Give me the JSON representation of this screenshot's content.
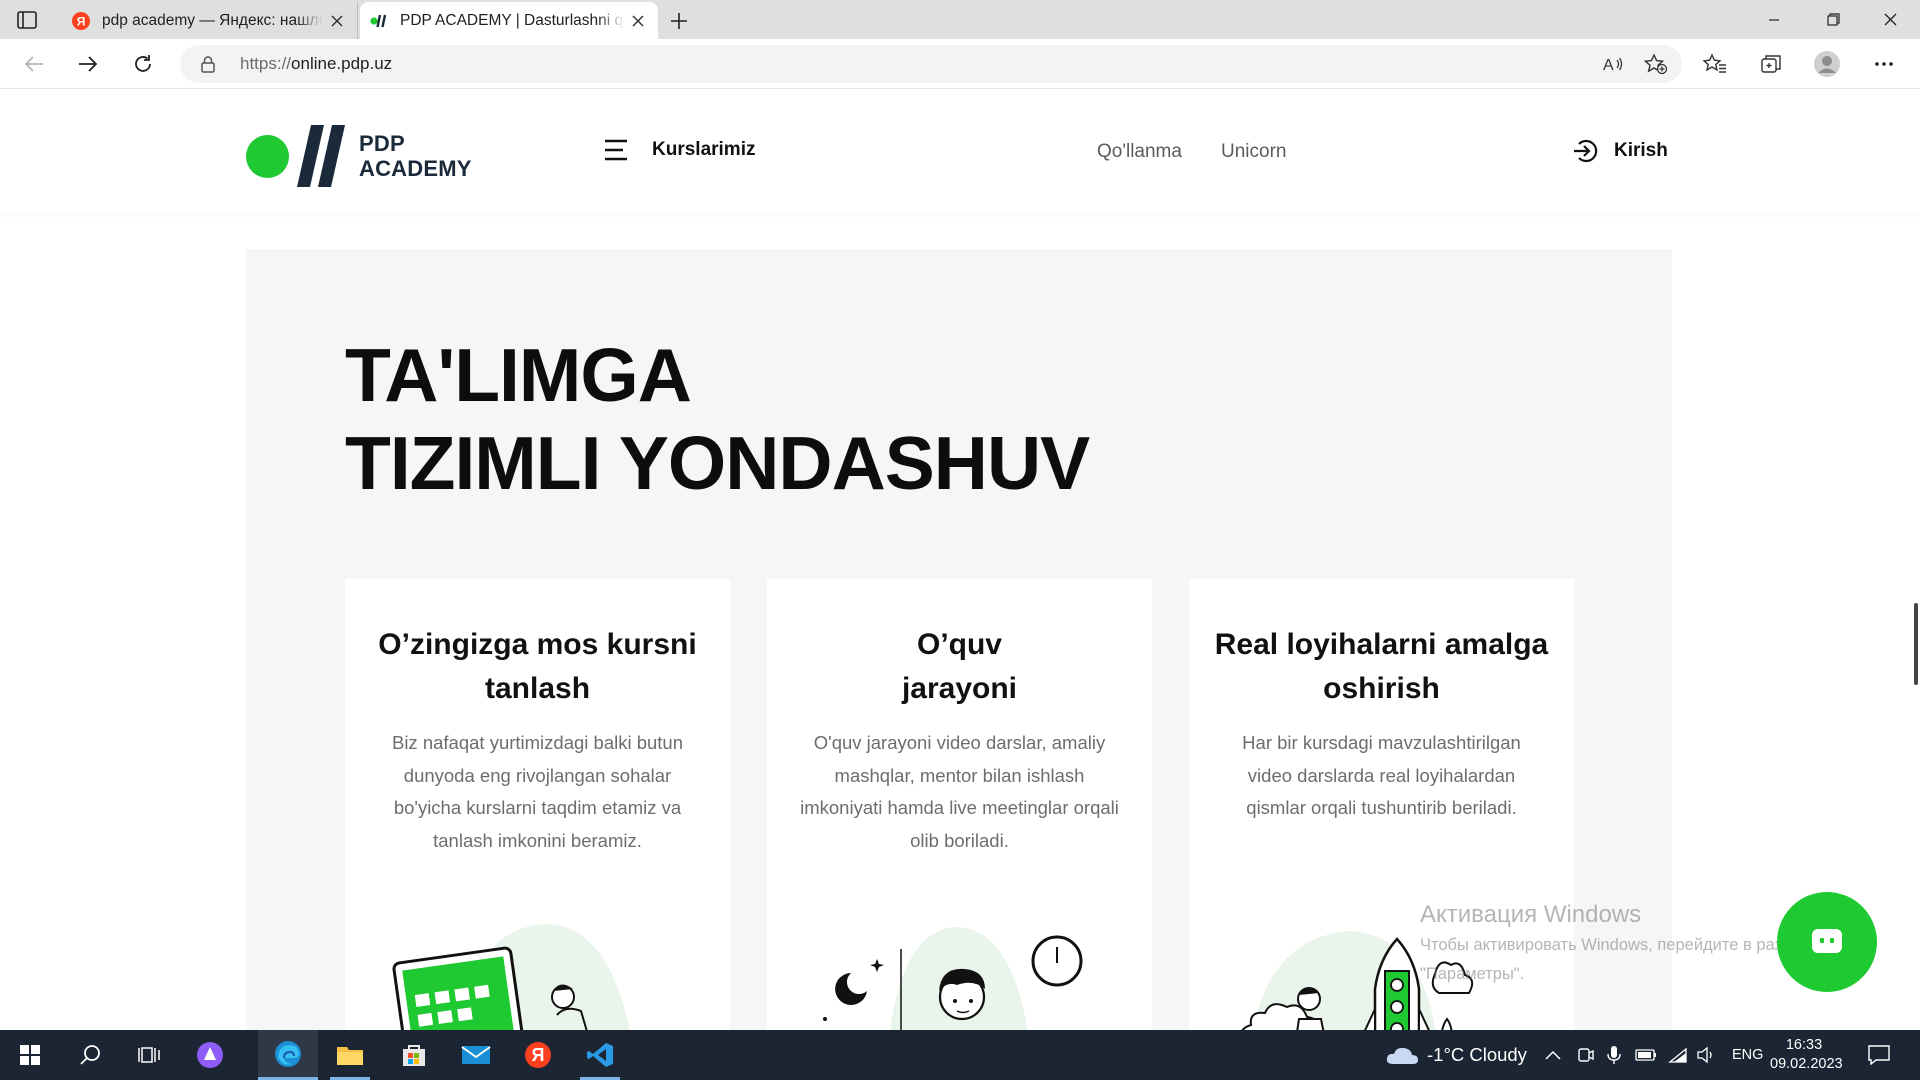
{
  "browser": {
    "tabs": [
      {
        "title": "pdp academy — Яндекс: нашлось",
        "favicon": "yandex-icon",
        "active": false
      },
      {
        "title": "PDP ACADEMY | Dasturlashni qulay",
        "favicon": "pdp-icon",
        "active": true
      }
    ],
    "url_scheme": "https://",
    "url_host": "online.pdp.uz"
  },
  "site": {
    "logo_line1": "PDP",
    "logo_line2": "ACADEMY",
    "courses_label": "Kurslarimiz",
    "nav": [
      "Qo'llanma",
      "Unicorn"
    ],
    "login_label": "Kirish",
    "accent": "#1ec931"
  },
  "hero": {
    "title_line1": "TA'LIMGA",
    "title_line2": "TIZIMLI YONDASHUV",
    "cards": [
      {
        "title_line1": "O’zingizga mos kursni",
        "title_line2": "tanlash",
        "text": "Biz nafaqat yurtimizdagi balki butun dunyoda eng rivojlangan sohalar bo'yicha kurslarni taqdim etamiz va tanlash imkonini beramiz."
      },
      {
        "title_line1": "O’quv",
        "title_line2": "jarayoni",
        "text": "O'quv jarayoni video darslar, amaliy mashqlar, mentor bilan ishlash imkoniyati hamda live meetinglar orqali olib boriladi."
      },
      {
        "title_line1": "Real loyihalarni amalga",
        "title_line2": "oshirish",
        "text": "Har bir kursdagi mavzulashtirilgan video darslarda real loyihalardan qismlar orqali tushuntirib beriladi."
      }
    ]
  },
  "overlay": {
    "activation_title": "Активация Windows",
    "activation_line1": "Чтобы активировать Windows, перейдите в раздел",
    "activation_line2": "\"Параметры\"."
  },
  "taskbar": {
    "weather": "-1°C  Cloudy",
    "lang": "ENG",
    "time": "16:33",
    "date": "09.02.2023"
  }
}
